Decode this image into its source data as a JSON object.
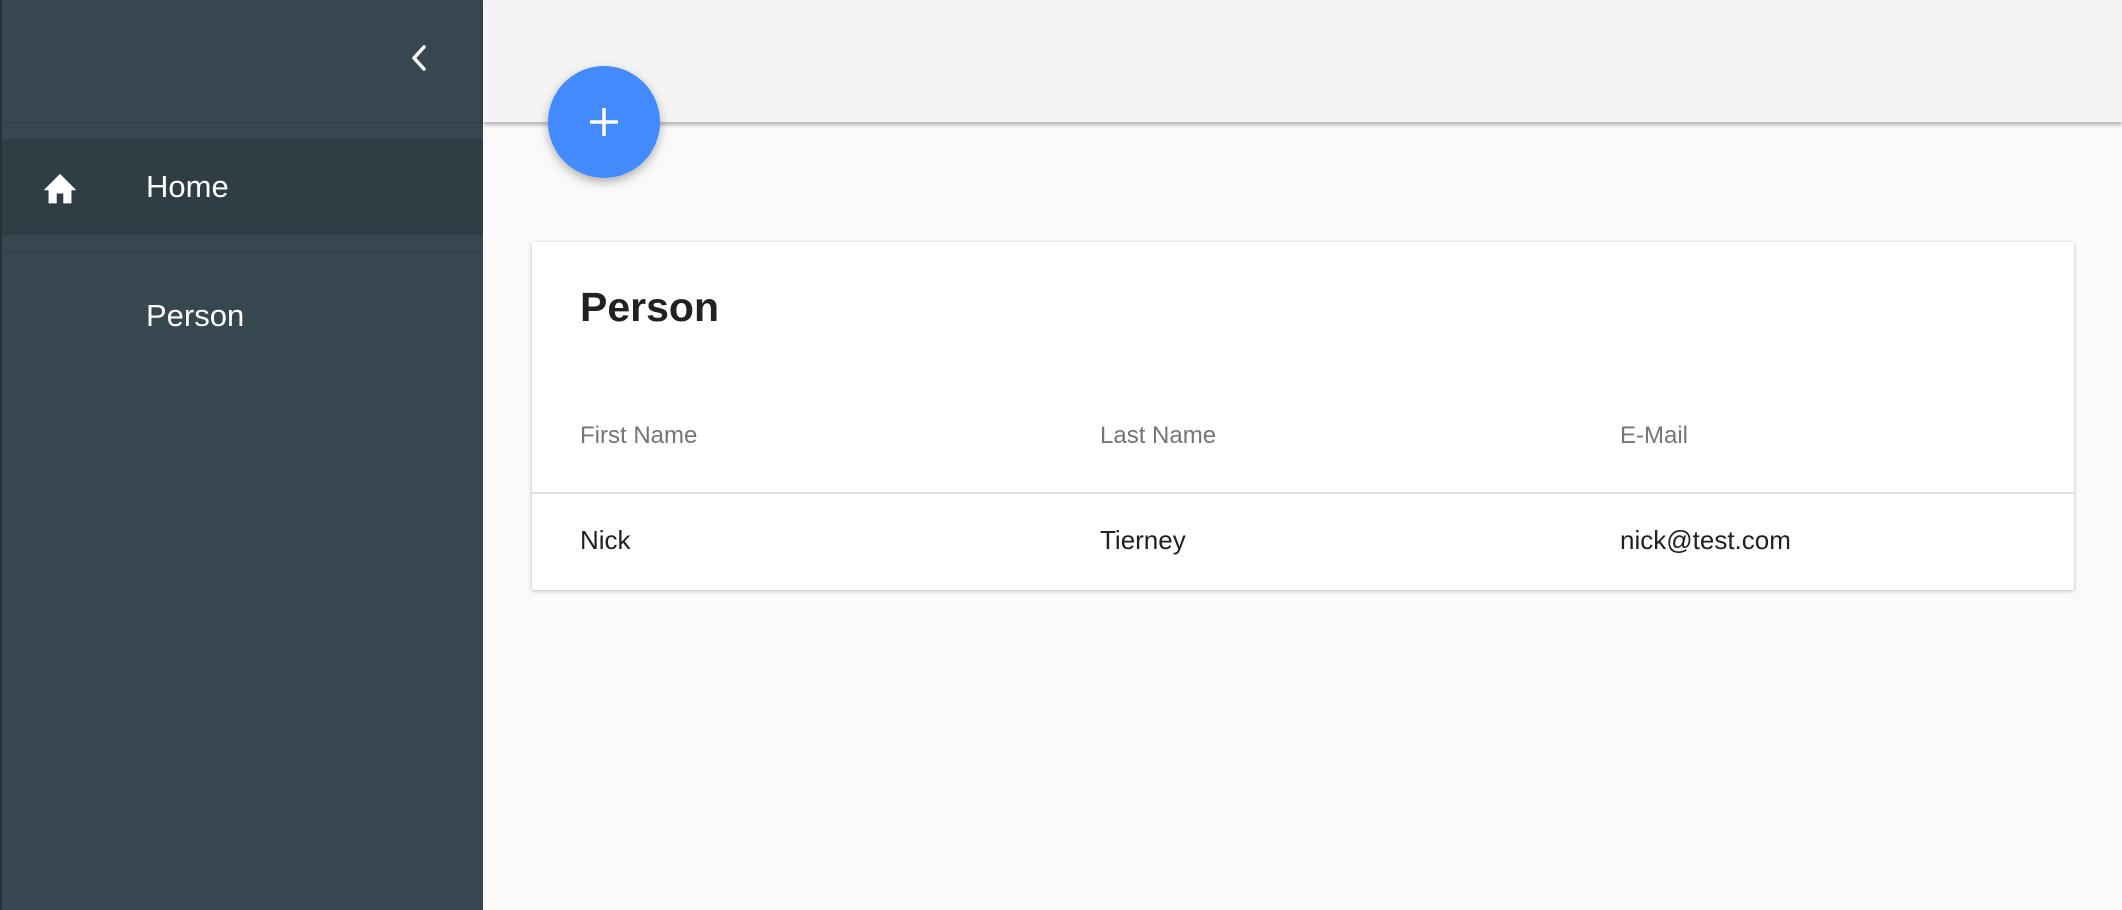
{
  "sidebar": {
    "collapse_icon": "chevron-left-icon",
    "items": [
      {
        "label": "Home",
        "icon": "home-icon",
        "active": true
      },
      {
        "label": "Person",
        "icon": "",
        "active": false
      }
    ]
  },
  "fab": {
    "icon": "plus-icon",
    "label": "+"
  },
  "card": {
    "title": "Person",
    "columns": [
      "First Name",
      "Last Name",
      "E-Mail"
    ],
    "rows": [
      [
        "Nick",
        "Tierney",
        "nick@test.com"
      ]
    ]
  },
  "colors": {
    "sidebar_bg": "#37474f",
    "active_item_bg": "#2f3d44",
    "fab": "#448aff",
    "topbar_bg": "#f4f4f4",
    "content_bg": "#fafafa"
  }
}
